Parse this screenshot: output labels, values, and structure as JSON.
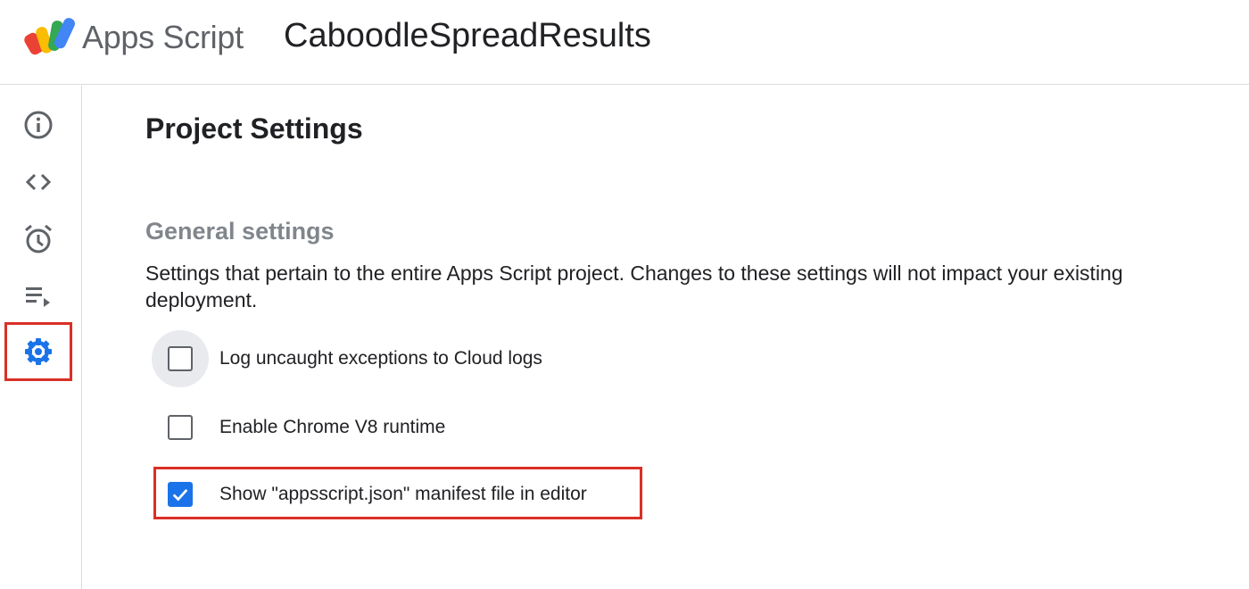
{
  "header": {
    "app_name": "Apps Script",
    "project_name": "CaboodleSpreadResults"
  },
  "sidebar": {
    "items": [
      {
        "icon": "info-icon",
        "active": false
      },
      {
        "icon": "code-icon",
        "active": false
      },
      {
        "icon": "alarm-clock-icon",
        "active": false
      },
      {
        "icon": "playlist-play-icon",
        "active": false
      },
      {
        "icon": "gear-icon",
        "active": true
      }
    ]
  },
  "main": {
    "title": "Project Settings",
    "general": {
      "heading": "General settings",
      "description": "Settings that pertain to the entire Apps Script project. Changes to these settings will not impact your existing deployment.",
      "options": [
        {
          "label": "Log uncaught exceptions to Cloud logs",
          "checked": false
        },
        {
          "label": "Enable Chrome V8 runtime",
          "checked": false
        },
        {
          "label": "Show \"appsscript.json\" manifest file in editor",
          "checked": true
        }
      ]
    }
  },
  "colors": {
    "accent": "#1a73e8",
    "highlight": "#d93025",
    "text": "#202124",
    "muted": "#5f6368",
    "divider": "#dadce0"
  }
}
